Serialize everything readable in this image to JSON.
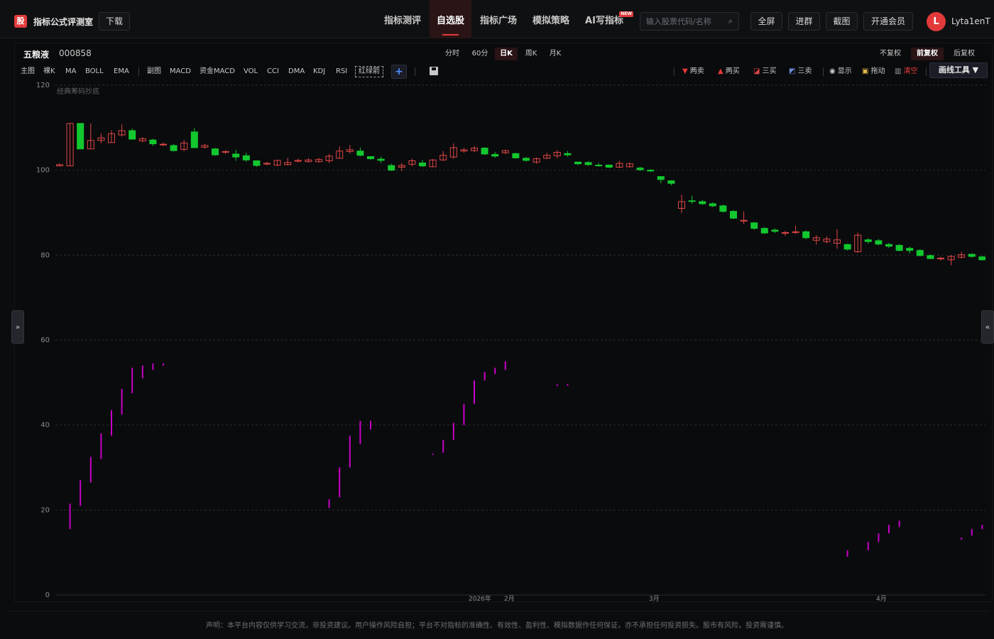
{
  "header": {
    "logo_glyph": "股",
    "brand": "指标公式评测室",
    "download_label": "下载",
    "nav": [
      {
        "label": "指标测评",
        "active": false
      },
      {
        "label": "自选股",
        "active": true
      },
      {
        "label": "指标广场",
        "active": false
      },
      {
        "label": "模拟策略",
        "active": false
      },
      {
        "label": "AI写指标",
        "active": false,
        "badge": "NEW"
      }
    ],
    "search_placeholder": "输入股票代码/名称",
    "fullscreen_label": "全屏",
    "group_label": "进群",
    "screenshot_label": "截图",
    "vip_label": "开通会员",
    "avatar_letter": "L",
    "username": "Lyta1enT"
  },
  "stock": {
    "name": "五粮液",
    "code": "000858"
  },
  "periods": [
    {
      "label": "分时",
      "active": false
    },
    {
      "label": "60分",
      "active": false
    },
    {
      "label": "日K",
      "active": true
    },
    {
      "label": "周K",
      "active": false
    },
    {
      "label": "月K",
      "active": false
    }
  ],
  "adjust": [
    {
      "label": "不复权",
      "active": false
    },
    {
      "label": "前复权",
      "active": true
    },
    {
      "label": "后复权",
      "active": false
    }
  ],
  "indicators": {
    "main_label": "主图",
    "main": [
      "裸K",
      "MA",
      "BOLL",
      "EMA"
    ],
    "sub_label": "副图",
    "sub": [
      "MACD",
      "资金MACD",
      "VOL",
      "CCI",
      "DMA",
      "KDJ",
      "RSI"
    ],
    "highlight": "红绿箭",
    "add": "+"
  },
  "tools": {
    "two_sell": "两卖",
    "two_buy": "两买",
    "three_buy": "三买",
    "three_sell": "三卖",
    "show": "显示",
    "drag": "拖动",
    "clear": "清空",
    "draw_tool": "画线工具 ▼"
  },
  "side_left": "»",
  "side_right": "«",
  "footer": "声明：本平台内容仅供学习交流，非投资建议。用户操作风险自担；平台不对指标的准确性、有效性、盈利性、模拟数据作任何保证，亦不承担任何投资损失。股市有风险，投资需谨慎。",
  "colors": {
    "up": "#e04646",
    "down": "#13c82f",
    "indicator": "#c800c8",
    "accent": "#e23a3a"
  },
  "chart_data": {
    "type": "candlestick",
    "overlay_label": "经典筹码抄底",
    "ylim": [
      0,
      120
    ],
    "y_ticks": [
      0,
      20,
      40,
      60,
      80,
      100,
      120
    ],
    "x_labels": [
      "2026年",
      "2月",
      "3月",
      "4月"
    ],
    "candles": [
      {
        "o": 101.0,
        "c": 101.3,
        "h": 101.6,
        "l": 100.9
      },
      {
        "o": 101.0,
        "c": 111.0,
        "h": 111.0,
        "l": 101.0
      },
      {
        "o": 111.0,
        "c": 105.0,
        "h": 111.0,
        "l": 105.0
      },
      {
        "o": 105.0,
        "c": 107.0,
        "h": 111.0,
        "l": 105.0
      },
      {
        "o": 107.0,
        "c": 107.6,
        "h": 108.6,
        "l": 106.3
      },
      {
        "o": 106.5,
        "c": 108.6,
        "h": 109.4,
        "l": 106.5
      },
      {
        "o": 108.3,
        "c": 109.3,
        "h": 110.8,
        "l": 107.9
      },
      {
        "o": 109.3,
        "c": 107.3,
        "h": 109.8,
        "l": 107.3
      },
      {
        "o": 106.9,
        "c": 107.4,
        "h": 107.8,
        "l": 106.6
      },
      {
        "o": 107.1,
        "c": 106.2,
        "h": 107.4,
        "l": 105.7
      },
      {
        "o": 106.1,
        "c": 106.1,
        "h": 106.5,
        "l": 105.7
      },
      {
        "o": 105.8,
        "c": 104.6,
        "h": 106.2,
        "l": 104.4
      },
      {
        "o": 104.9,
        "c": 106.4,
        "h": 107.1,
        "l": 104.5
      },
      {
        "o": 109.0,
        "c": 105.3,
        "h": 109.9,
        "l": 105.3
      },
      {
        "o": 105.4,
        "c": 105.8,
        "h": 106.2,
        "l": 105.1
      },
      {
        "o": 105.0,
        "c": 103.6,
        "h": 105.2,
        "l": 103.4
      },
      {
        "o": 104.2,
        "c": 104.4,
        "h": 104.7,
        "l": 103.8
      },
      {
        "o": 103.8,
        "c": 103.1,
        "h": 104.8,
        "l": 102.2
      },
      {
        "o": 103.4,
        "c": 102.4,
        "h": 104.1,
        "l": 102.0
      },
      {
        "o": 102.2,
        "c": 101.1,
        "h": 102.3,
        "l": 100.8
      },
      {
        "o": 101.5,
        "c": 101.6,
        "h": 102.0,
        "l": 101.2
      },
      {
        "o": 101.2,
        "c": 102.3,
        "h": 102.4,
        "l": 100.9
      },
      {
        "o": 101.3,
        "c": 101.8,
        "h": 102.9,
        "l": 101.1
      },
      {
        "o": 102.1,
        "c": 102.3,
        "h": 102.7,
        "l": 101.8
      },
      {
        "o": 102.0,
        "c": 102.4,
        "h": 102.8,
        "l": 101.8
      },
      {
        "o": 102.0,
        "c": 102.5,
        "h": 102.9,
        "l": 101.8
      },
      {
        "o": 102.2,
        "c": 103.3,
        "h": 103.8,
        "l": 101.7
      },
      {
        "o": 102.8,
        "c": 104.5,
        "h": 105.6,
        "l": 102.8
      },
      {
        "o": 104.4,
        "c": 104.8,
        "h": 105.9,
        "l": 103.9
      },
      {
        "o": 104.5,
        "c": 103.5,
        "h": 105.3,
        "l": 103.3
      },
      {
        "o": 103.2,
        "c": 102.7,
        "h": 103.3,
        "l": 102.4
      },
      {
        "o": 102.6,
        "c": 102.3,
        "h": 103.2,
        "l": 101.7
      },
      {
        "o": 101.1,
        "c": 100.0,
        "h": 101.5,
        "l": 99.8
      },
      {
        "o": 100.7,
        "c": 101.1,
        "h": 101.7,
        "l": 99.8
      },
      {
        "o": 101.4,
        "c": 102.2,
        "h": 102.7,
        "l": 100.9
      },
      {
        "o": 101.7,
        "c": 101.0,
        "h": 102.4,
        "l": 100.8
      },
      {
        "o": 100.8,
        "c": 102.4,
        "h": 102.6,
        "l": 100.7
      },
      {
        "o": 102.4,
        "c": 103.5,
        "h": 104.5,
        "l": 102.2
      },
      {
        "o": 103.1,
        "c": 105.3,
        "h": 106.3,
        "l": 102.7
      },
      {
        "o": 104.5,
        "c": 104.8,
        "h": 105.2,
        "l": 104.1
      },
      {
        "o": 104.6,
        "c": 105.2,
        "h": 105.6,
        "l": 104.3
      },
      {
        "o": 105.2,
        "c": 103.8,
        "h": 105.4,
        "l": 103.6
      },
      {
        "o": 103.7,
        "c": 103.3,
        "h": 104.3,
        "l": 102.9
      },
      {
        "o": 104.1,
        "c": 104.6,
        "h": 104.8,
        "l": 103.8
      },
      {
        "o": 103.9,
        "c": 102.9,
        "h": 104.1,
        "l": 102.7
      },
      {
        "o": 102.8,
        "c": 102.3,
        "h": 103.1,
        "l": 102.0
      },
      {
        "o": 101.9,
        "c": 102.7,
        "h": 103.0,
        "l": 101.5
      },
      {
        "o": 102.8,
        "c": 103.5,
        "h": 104.1,
        "l": 102.6
      },
      {
        "o": 103.4,
        "c": 104.2,
        "h": 104.7,
        "l": 102.8
      },
      {
        "o": 103.9,
        "c": 103.6,
        "h": 104.5,
        "l": 103.2
      },
      {
        "o": 101.9,
        "c": 101.5,
        "h": 102.0,
        "l": 101.2
      },
      {
        "o": 101.8,
        "c": 101.3,
        "h": 102.1,
        "l": 101.0
      },
      {
        "o": 101.2,
        "c": 101.1,
        "h": 101.7,
        "l": 100.8
      },
      {
        "o": 101.2,
        "c": 100.7,
        "h": 101.3,
        "l": 100.5
      },
      {
        "o": 100.7,
        "c": 101.6,
        "h": 102.2,
        "l": 100.5
      },
      {
        "o": 100.8,
        "c": 101.5,
        "h": 101.8,
        "l": 100.6
      },
      {
        "o": 100.5,
        "c": 100.1,
        "h": 100.8,
        "l": 99.8
      },
      {
        "o": 100.0,
        "c": 99.8,
        "h": 100.2,
        "l": 99.6
      },
      {
        "o": 98.5,
        "c": 97.8,
        "h": 98.5,
        "l": 96.9
      },
      {
        "o": 97.5,
        "c": 96.9,
        "h": 97.6,
        "l": 96.4
      },
      {
        "o": 91.0,
        "c": 92.6,
        "h": 94.2,
        "l": 89.9
      },
      {
        "o": 92.8,
        "c": 92.7,
        "h": 94.0,
        "l": 92.1
      },
      {
        "o": 92.6,
        "c": 92.1,
        "h": 93.0,
        "l": 91.8
      },
      {
        "o": 92.1,
        "c": 91.6,
        "h": 92.4,
        "l": 91.3
      },
      {
        "o": 91.6,
        "c": 90.3,
        "h": 91.9,
        "l": 90.0
      },
      {
        "o": 90.3,
        "c": 88.7,
        "h": 90.6,
        "l": 88.5
      },
      {
        "o": 88.0,
        "c": 88.2,
        "h": 90.3,
        "l": 87.3
      },
      {
        "o": 87.6,
        "c": 86.3,
        "h": 87.8,
        "l": 86.0
      },
      {
        "o": 86.3,
        "c": 85.2,
        "h": 86.6,
        "l": 85.0
      },
      {
        "o": 85.9,
        "c": 85.6,
        "h": 86.3,
        "l": 85.2
      },
      {
        "o": 85.3,
        "c": 85.3,
        "h": 85.7,
        "l": 84.5
      },
      {
        "o": 85.3,
        "c": 85.5,
        "h": 86.9,
        "l": 85.0
      },
      {
        "o": 85.5,
        "c": 84.1,
        "h": 85.8,
        "l": 83.8
      },
      {
        "o": 83.5,
        "c": 84.1,
        "h": 84.7,
        "l": 82.5
      },
      {
        "o": 83.2,
        "c": 83.8,
        "h": 84.4,
        "l": 82.8
      },
      {
        "o": 82.8,
        "c": 83.6,
        "h": 86.1,
        "l": 81.5
      },
      {
        "o": 82.5,
        "c": 81.4,
        "h": 82.7,
        "l": 81.1
      },
      {
        "o": 80.8,
        "c": 84.7,
        "h": 85.3,
        "l": 80.6
      },
      {
        "o": 83.6,
        "c": 83.2,
        "h": 84.0,
        "l": 82.7
      },
      {
        "o": 83.4,
        "c": 82.6,
        "h": 83.8,
        "l": 82.3
      },
      {
        "o": 82.5,
        "c": 82.1,
        "h": 82.9,
        "l": 81.7
      },
      {
        "o": 82.3,
        "c": 81.1,
        "h": 82.6,
        "l": 80.9
      },
      {
        "o": 81.6,
        "c": 81.1,
        "h": 82.0,
        "l": 80.4
      },
      {
        "o": 81.1,
        "c": 79.9,
        "h": 81.4,
        "l": 79.7
      },
      {
        "o": 79.9,
        "c": 79.2,
        "h": 80.2,
        "l": 79.0
      },
      {
        "o": 79.1,
        "c": 79.3,
        "h": 79.6,
        "l": 78.7
      },
      {
        "o": 78.9,
        "c": 79.7,
        "h": 80.0,
        "l": 77.6
      },
      {
        "o": 79.5,
        "c": 80.1,
        "h": 80.8,
        "l": 79.2
      },
      {
        "o": 80.2,
        "c": 79.7,
        "h": 80.4,
        "l": 79.4
      },
      {
        "o": 79.6,
        "c": 78.9,
        "h": 79.8,
        "l": 78.7
      }
    ],
    "indicator_bars": [
      {
        "i": 1,
        "from": 15.5,
        "to": 21.5
      },
      {
        "i": 2,
        "from": 21.0,
        "to": 27.0
      },
      {
        "i": 3,
        "from": 26.5,
        "to": 32.5
      },
      {
        "i": 4,
        "from": 32.0,
        "to": 38.0
      },
      {
        "i": 5,
        "from": 37.5,
        "to": 43.5
      },
      {
        "i": 6,
        "from": 42.5,
        "to": 48.5
      },
      {
        "i": 7,
        "from": 47.5,
        "to": 53.5
      },
      {
        "i": 8,
        "from": 51.0,
        "to": 54.0
      },
      {
        "i": 9,
        "from": 53.0,
        "to": 54.5
      },
      {
        "i": 10,
        "from": 54.0,
        "to": 54.5
      },
      {
        "i": 26,
        "from": 20.5,
        "to": 22.5
      },
      {
        "i": 27,
        "from": 23.0,
        "to": 30.0
      },
      {
        "i": 28,
        "from": 30.0,
        "to": 37.5
      },
      {
        "i": 29,
        "from": 35.5,
        "to": 41.0
      },
      {
        "i": 30,
        "from": 39.0,
        "to": 41.0
      },
      {
        "i": 36,
        "from": 33.0,
        "to": 33.3
      },
      {
        "i": 37,
        "from": 33.5,
        "to": 36.5
      },
      {
        "i": 38,
        "from": 36.5,
        "to": 40.5
      },
      {
        "i": 39,
        "from": 40.0,
        "to": 45.0
      },
      {
        "i": 40,
        "from": 45.0,
        "to": 50.5
      },
      {
        "i": 41,
        "from": 50.5,
        "to": 52.5
      },
      {
        "i": 42,
        "from": 52.0,
        "to": 53.5
      },
      {
        "i": 43,
        "from": 53.0,
        "to": 55.0
      },
      {
        "i": 48,
        "from": 49.2,
        "to": 49.6
      },
      {
        "i": 49,
        "from": 49.3,
        "to": 49.7
      },
      {
        "i": 76,
        "from": 9.0,
        "to": 10.5
      },
      {
        "i": 78,
        "from": 10.5,
        "to": 12.5
      },
      {
        "i": 79,
        "from": 12.5,
        "to": 14.5
      },
      {
        "i": 80,
        "from": 14.5,
        "to": 16.5
      },
      {
        "i": 81,
        "from": 16.0,
        "to": 17.5
      },
      {
        "i": 87,
        "from": 13.0,
        "to": 13.5
      },
      {
        "i": 88,
        "from": 14.0,
        "to": 15.5
      },
      {
        "i": 89,
        "from": 15.5,
        "to": 16.5
      },
      {
        "i": 90,
        "from": 16.2,
        "to": 16.6
      }
    ]
  }
}
